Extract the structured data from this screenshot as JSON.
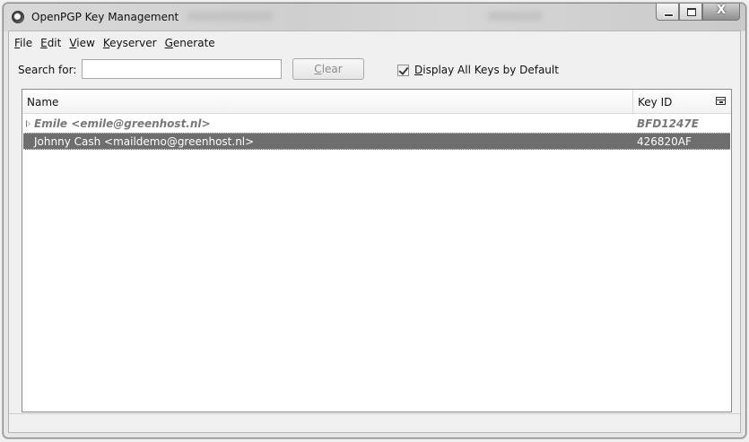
{
  "window": {
    "title": "OpenPGP Key Management",
    "close_glyph": "X"
  },
  "menu": {
    "items": [
      {
        "label": "File",
        "mnemonic": "F",
        "rest": "ile"
      },
      {
        "label": "Edit",
        "mnemonic": "E",
        "rest": "dit"
      },
      {
        "label": "View",
        "mnemonic": "V",
        "rest": "iew"
      },
      {
        "label": "Keyserver",
        "mnemonic": "K",
        "rest": "eyserver"
      },
      {
        "label": "Generate",
        "mnemonic": "G",
        "rest": "enerate"
      }
    ]
  },
  "search": {
    "label": "Search for:",
    "value": "",
    "placeholder": "",
    "clear_mnemonic": "C",
    "clear_rest": "lear"
  },
  "display_all": {
    "checked": true,
    "mnemonic": "D",
    "rest": "isplay All Keys by Default"
  },
  "tree": {
    "columns": {
      "name": "Name",
      "key_id": "Key ID"
    },
    "rows": [
      {
        "name": "Emile <emile@greenhost.nl>",
        "key_id": "BFD1247E",
        "selected": false,
        "has_children": true
      },
      {
        "name": "Johnny Cash <maildemo@greenhost.nl>",
        "key_id": "426820AF",
        "selected": true,
        "has_children": false
      }
    ]
  }
}
